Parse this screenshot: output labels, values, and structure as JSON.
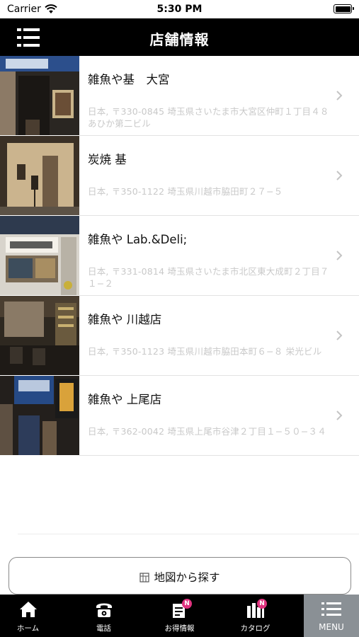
{
  "status_bar": {
    "carrier": "Carrier",
    "time": "5:30 PM"
  },
  "header": {
    "title": "店舗情報"
  },
  "stores": [
    {
      "name": "雑魚や基　大宮",
      "address": "日本, 〒330-0845 埼玉県さいたま市大宮区仲町１丁目４８ あひか第二ビル",
      "photo": "storefront-night-entrance"
    },
    {
      "name": "炭焼 基",
      "address": "日本, 〒350-1122 埼玉県川越市脇田町２７−５",
      "photo": "storefront-beige-wall"
    },
    {
      "name": "雑魚や Lab.&Deli;",
      "address": "日本, 〒331-0814 埼玉県さいたま市北区東大成町２丁目７１−２",
      "photo": "shop-sign-lab-deli"
    },
    {
      "name": "雑魚や 川越店",
      "address": "日本, 〒350-1123 埼玉県川越市脇田本町６−８ 栄光ビル",
      "photo": "restaurant-interior"
    },
    {
      "name": "雑魚や 上尾店",
      "address": "日本, 〒362-0042 埼玉県上尾市谷津２丁目１−５０−３４",
      "photo": "storefront-blue-sign"
    }
  ],
  "map_button": {
    "label": "地図から探す",
    "icon": "map-icon"
  },
  "tab_bar": {
    "tabs": [
      {
        "label": "ホーム",
        "icon": "home-icon",
        "active": false
      },
      {
        "label": "電話",
        "icon": "phone-icon",
        "active": false
      },
      {
        "label": "お得情報",
        "icon": "coupon-icon",
        "badge": "N",
        "active": false
      },
      {
        "label": "カタログ",
        "icon": "catalog-icon",
        "badge": "N",
        "active": false
      },
      {
        "label": "MENU",
        "icon": "menu-icon",
        "active": true
      }
    ]
  },
  "colors": {
    "header_bg": "#000000",
    "badge": "#e0337f",
    "active_tab_bg": "#8a9095",
    "address_text": "#c9c9c9"
  }
}
